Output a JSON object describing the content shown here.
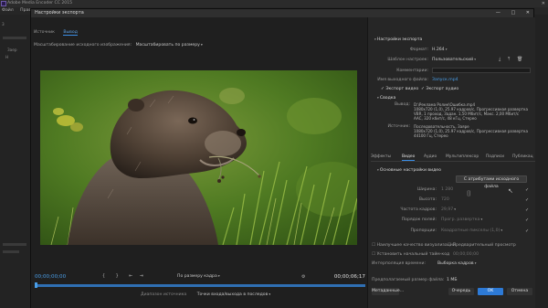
{
  "app": {
    "title": "Adobe Media Encoder CC 2015",
    "menu": [
      "Файл",
      "Правка"
    ],
    "window_controls": [
      "–",
      "□",
      "✕"
    ]
  },
  "bg_left": {
    "row1": "3",
    "row2": "Заер",
    "row3": "H"
  },
  "dialog": {
    "title": "Настройки экспорта",
    "controls": [
      "—",
      "□",
      "✕"
    ]
  },
  "left": {
    "tabs": [
      "Источник",
      "Вывод"
    ],
    "source_scaling_label": "Масштабирование исходного изображения:",
    "source_scaling_value": "Масштабировать по размеру",
    "time_start": "00;00;00;00",
    "time_end": "00;00;06;17",
    "fit_value": "По размеру кадра",
    "source_range_label": "Диапазон источника",
    "source_range_value": "Точки входа/выхода в последов"
  },
  "right": {
    "export_settings_header": "Настройки экспорта",
    "format_label": "Формат:",
    "format_value": "H.264",
    "preset_label": "Шаблон настроек:",
    "preset_value": "Пользовательский",
    "comments_label": "Комментарии:",
    "output_name_label": "Имя выходного файла:",
    "output_name_value": "Запуск.mp4",
    "export_video": "Экспорт видео",
    "export_audio": "Экспорт аудио",
    "summary_header": "Сводка",
    "output_label": "Вывод:",
    "output_lines": [
      "D:\\Реклама Ролик\\Ошибка.mp4",
      "1080x720 (1,0), 25.97 кадров/с, Прогрессивная развертка",
      "VBR, 1 проход, Задан. 1,50 Мбит/с, Макс. 2,00 Мбит/с",
      "AAC, 320 кбит/с, 48 кГц, Стерео"
    ],
    "source_label": "Источник:",
    "source_lines": [
      "Последовательность, Заяре",
      "1080x720 (1,0), 25.97 кадров/с, Прогрессивная развертка",
      "44100 Гц, Стерео"
    ],
    "tabs": [
      "Эффекты",
      "Видео",
      "Аудио",
      "Мультиплексор",
      "Подписи",
      "Публикац"
    ],
    "basic_video_header": "Основные настройки видео",
    "match_source_button": "С атрибутами исходного файла",
    "width_label": "Ширина:",
    "width_value": "1 280",
    "height_label": "Высота:",
    "height_value": "720",
    "frame_rate_label": "Частота кадров:",
    "frame_rate_value": "29,97",
    "field_order_label": "Порядок полей:",
    "field_order_value": "Прогр. развертка",
    "aspect_label": "Пропорции:",
    "aspect_value": "Квадратные пикселы (1,0)",
    "max_render_quality": "Наилучшее качество визуализации",
    "use_previews": "Предварительный просмотр",
    "set_start_timecode": "Установить начальный тайм-код",
    "start_timecode_value": "00;00;00;00",
    "interpolation_label": "Интерполяция времени:",
    "interpolation_value": "Выборка кадров",
    "estimated_size_label": "Предполагаемый размер файла:",
    "estimated_size_value": "1 МБ",
    "metadata_button": "Метаданные...",
    "queue_button": "Очередь",
    "ok_button": "OK",
    "cancel_button": "Отмена"
  },
  "colors": {
    "accent": "#2d7ad6",
    "link": "#4a9ee8"
  }
}
